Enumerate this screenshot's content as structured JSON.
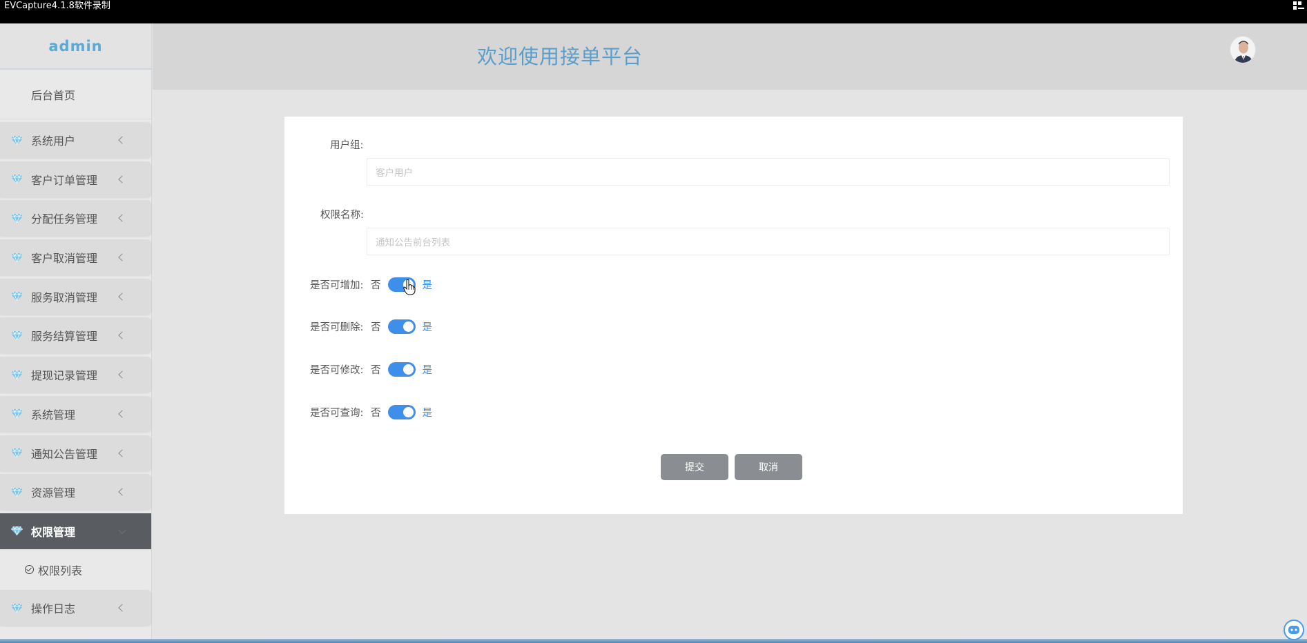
{
  "window": {
    "title": "EVCapture4.1.8软件录制"
  },
  "sidebar": {
    "brand": "admin",
    "home": "后台首页",
    "items": [
      {
        "label": "系统用户"
      },
      {
        "label": "客户订单管理"
      },
      {
        "label": "分配任务管理"
      },
      {
        "label": "客户取消管理"
      },
      {
        "label": "服务取消管理"
      },
      {
        "label": "服务结算管理"
      },
      {
        "label": "提现记录管理"
      },
      {
        "label": "系统管理"
      },
      {
        "label": "通知公告管理"
      },
      {
        "label": "资源管理"
      },
      {
        "label": "权限管理",
        "active": true
      },
      {
        "label": "操作日志"
      }
    ],
    "submenu": {
      "label": "权限列表"
    }
  },
  "header": {
    "title": "欢迎使用接单平台"
  },
  "form": {
    "user_group": {
      "label": "用户组:",
      "placeholder": "客户用户"
    },
    "perm_name": {
      "label": "权限名称:",
      "placeholder": "通知公告前台列表"
    },
    "switches": [
      {
        "label": "是否可增加:",
        "off": "否",
        "on": "是",
        "value": true
      },
      {
        "label": "是否可删除:",
        "off": "否",
        "on": "是",
        "value": true
      },
      {
        "label": "是否可修改:",
        "off": "否",
        "on": "是",
        "value": true
      },
      {
        "label": "是否可查询:",
        "off": "否",
        "on": "是",
        "value": true
      }
    ],
    "submit": "提交",
    "cancel": "取消"
  },
  "colors": {
    "accent": "#3d8fea",
    "title": "#5b9ec9",
    "active_menu": "#595d62",
    "button": "#8a8e92"
  }
}
